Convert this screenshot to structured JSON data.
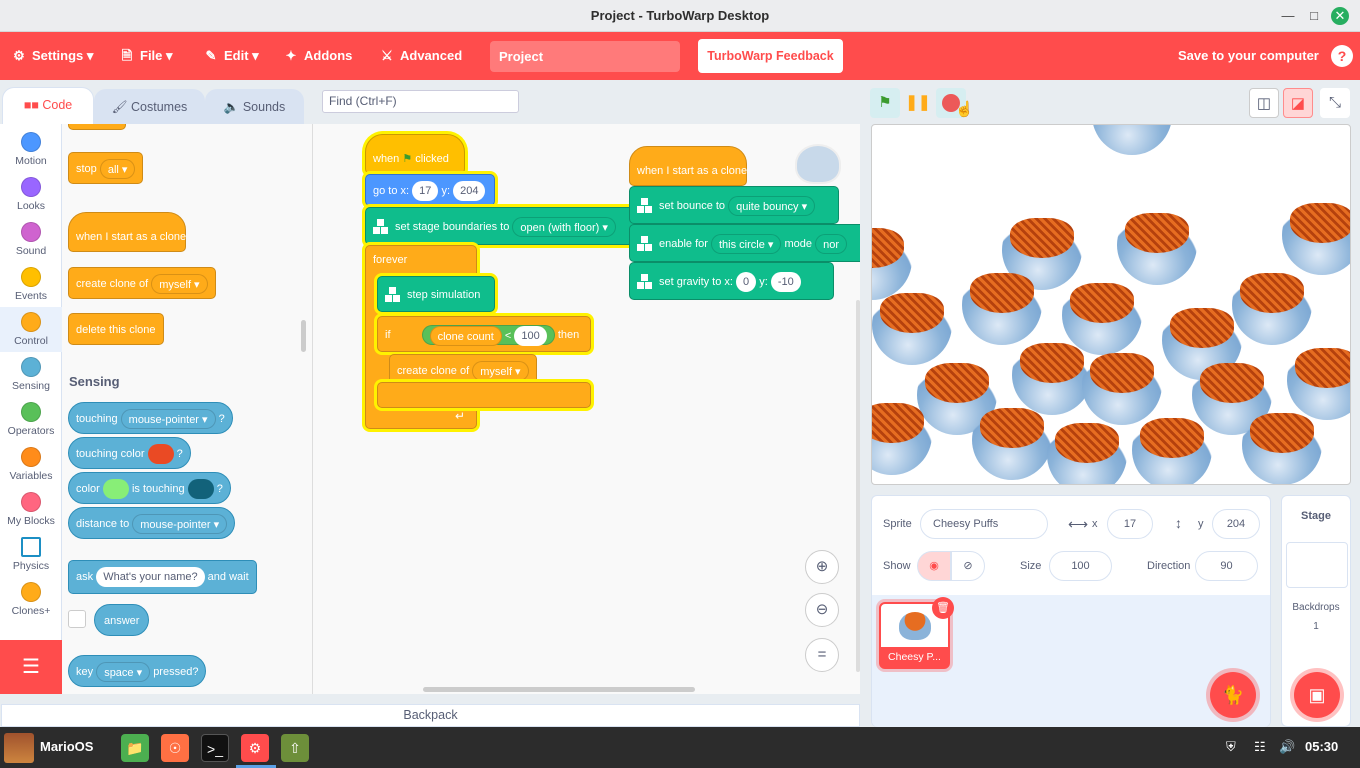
{
  "window": {
    "title": "Project - TurboWarp Desktop",
    "minimize_icon": "minimize-icon",
    "maximize_icon": "maximize-icon",
    "close_icon": "close-icon",
    "close_color": "#27ae60"
  },
  "menubar": {
    "settings": "Settings",
    "file": "File",
    "edit": "Edit",
    "addons": "Addons",
    "advanced": "Advanced",
    "project_title": "Project",
    "feedback": "TurboWarp Feedback",
    "save": "Save to your computer",
    "help": "?",
    "bg_color": "#ff4c4c"
  },
  "tabs": {
    "code": "Code",
    "costumes": "Costumes",
    "sounds": "Sounds"
  },
  "find": {
    "placeholder": "Find (Ctrl+F)"
  },
  "categories": [
    {
      "label": "Motion",
      "color": "#4c97ff"
    },
    {
      "label": "Looks",
      "color": "#9966ff"
    },
    {
      "label": "Sound",
      "color": "#cf63cf"
    },
    {
      "label": "Events",
      "color": "#ffbf00"
    },
    {
      "label": "Control",
      "color": "#ffab19"
    },
    {
      "label": "Sensing",
      "color": "#5cb1d6"
    },
    {
      "label": "Operators",
      "color": "#59c059"
    },
    {
      "label": "Variables",
      "color": "#ff8c1a"
    },
    {
      "label": "My Blocks",
      "color": "#ff6680"
    },
    {
      "label": "Physics",
      "color": "#0fbd8c"
    },
    {
      "label": "Clones+",
      "color": "#ffab19"
    }
  ],
  "palette": {
    "stop": "stop",
    "stop_opt": "all",
    "when_clone": "when I start as a clone",
    "create_clone": "create clone of",
    "create_clone_opt": "myself",
    "delete_clone": "delete this clone",
    "sensing_heading": "Sensing",
    "touching": "touching",
    "touching_opt": "mouse-pointer",
    "q": "?",
    "touching_color": "touching color",
    "color": "color",
    "is_touching": "is touching",
    "distance_to": "distance to",
    "distance_opt": "mouse-pointer",
    "ask": "ask",
    "ask_default": "What's your name?",
    "and_wait": "and wait",
    "answer": "answer",
    "key": "key",
    "key_opt": "space",
    "pressed": "pressed?",
    "color1": "#ea4a24",
    "color2": "#88ee77",
    "color3": "#12627a"
  },
  "script1": {
    "when": "when",
    "clicked": "clicked",
    "goto_x": "go to x:",
    "x_val": "17",
    "y_lbl": "y:",
    "y_val": "204",
    "set_bounds": "set stage boundaries to",
    "bounds_opt": "open (with floor)",
    "forever": "forever",
    "step": "step simulation",
    "if": "if",
    "clone_count": "clone count",
    "lt": "<",
    "limit": "100",
    "then": "then",
    "create_clone": "create clone of",
    "clone_opt": "myself"
  },
  "script2": {
    "when_clone": "when I start as a clone",
    "set_bounce": "set bounce to",
    "bounce_opt": "quite bouncy",
    "enable_for": "enable for",
    "enable_opt": "this circle",
    "mode": "mode",
    "mode_opt": "nor",
    "set_gravity": "set gravity to x:",
    "gx": "0",
    "gy_lbl": "y:",
    "gy": "-10"
  },
  "backpack": "Backpack",
  "sprite_info": {
    "sprite_lbl": "Sprite",
    "name": "Cheesy Puffs",
    "x_lbl": "x",
    "x": "17",
    "y_lbl": "y",
    "y": "204",
    "show_lbl": "Show",
    "size_lbl": "Size",
    "size": "100",
    "direction_lbl": "Direction",
    "direction": "90",
    "thumb_label": "Cheesy P..."
  },
  "stage_panel": {
    "title": "Stage",
    "backdrops_lbl": "Backdrops",
    "backdrops": "1"
  },
  "taskbar": {
    "os": "MarioOS",
    "time": "05:30"
  }
}
